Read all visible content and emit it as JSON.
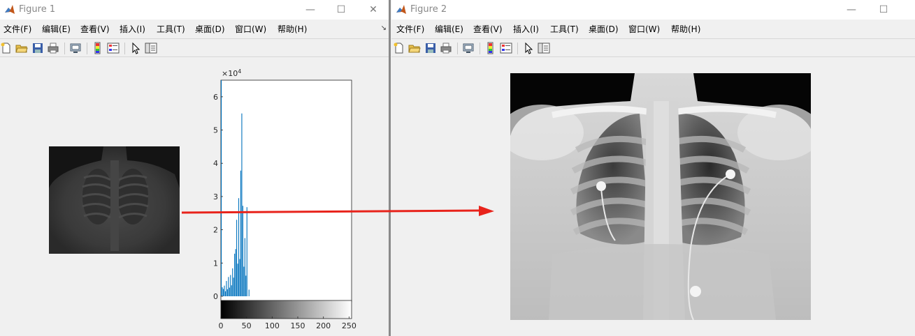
{
  "figure1": {
    "title": "Figure 1",
    "menus": [
      "文件(F)",
      "编辑(E)",
      "查看(V)",
      "插入(I)",
      "工具(T)",
      "桌面(D)",
      "窗口(W)",
      "帮助(H)"
    ],
    "dock_glyph": "↘"
  },
  "figure2": {
    "title": "Figure 2",
    "menus": [
      "文件(F)",
      "编辑(E)",
      "查看(V)",
      "插入(I)",
      "工具(T)",
      "桌面(D)",
      "窗口(W)",
      "帮助(H)"
    ]
  },
  "window_controls": {
    "minimize": "—",
    "maximize": "☐",
    "close": "✕"
  },
  "toolbar_icons": [
    "new-figure-icon",
    "open-file-icon",
    "save-icon",
    "print-icon",
    "link-plot-icon",
    "insert-colorbar-icon",
    "insert-legend-icon",
    "edit-plot-arrow-icon",
    "property-inspector-icon"
  ],
  "colors": {
    "histogram_bar": "#0072bd",
    "annotation_arrow": "#e8231b",
    "titlebar": "#ffffff",
    "window_bg": "#f0f0f0"
  },
  "chart_data": {
    "type": "bar",
    "title": "",
    "xlabel": "",
    "ylabel": "",
    "exponent_label": "×10",
    "exponent_power": "4",
    "xlim": [
      0,
      255
    ],
    "ylim": [
      0,
      65000
    ],
    "xticks": [
      0,
      50,
      100,
      150,
      200,
      250
    ],
    "yticks": [
      0,
      1,
      2,
      3,
      4,
      5,
      6
    ],
    "y_tick_multiplier": 10000,
    "x": [
      0,
      2,
      4,
      6,
      8,
      10,
      12,
      14,
      16,
      18,
      20,
      22,
      24,
      26,
      28,
      30,
      32,
      34,
      36,
      38,
      40,
      42,
      44,
      46,
      48,
      50,
      54
    ],
    "values": [
      65000,
      2700,
      2200,
      3200,
      1500,
      4600,
      2100,
      5800,
      2600,
      6400,
      3300,
      8400,
      5600,
      12800,
      14200,
      23000,
      9800,
      29500,
      11200,
      37800,
      55000,
      27200,
      8900,
      17500,
      6200,
      26800,
      2000
    ]
  }
}
